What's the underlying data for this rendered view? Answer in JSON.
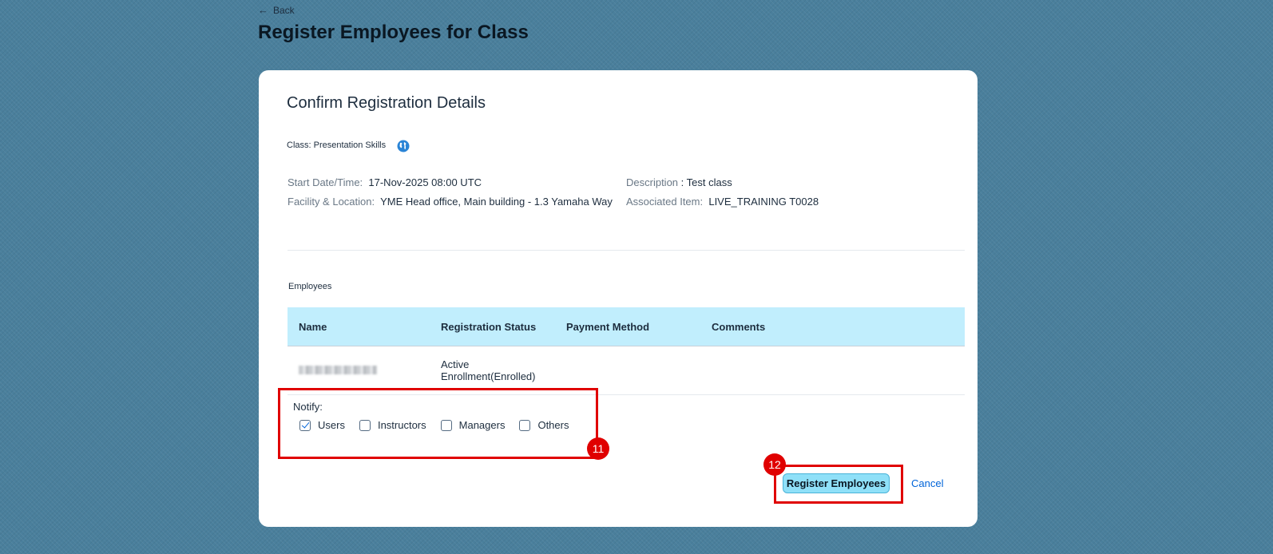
{
  "nav": {
    "back_label": "Back",
    "back_icon": "arrow-left-icon"
  },
  "page": {
    "title": "Register Employees for Class"
  },
  "card": {
    "title": "Confirm Registration Details",
    "class_label": "Class: Presentation Skills",
    "globe_icon": "globe-icon",
    "details": {
      "start_label": "Start Date/Time:",
      "start_value": "17-Nov-2025 08:00 UTC",
      "facility_label": "Facility & Location:",
      "facility_value": "YME Head office, Main building - 1.3 Yamaha Way",
      "description_label": "Description",
      "description_value": ": Test class",
      "associated_label": "Associated Item:",
      "associated_value": "LIVE_TRAINING T0028"
    },
    "employees_label": "Employees",
    "table": {
      "headers": [
        "Name",
        "Registration Status",
        "Payment Method",
        "Comments"
      ],
      "rows": [
        {
          "status": "Active Enrollment(Enrolled)",
          "payment": "",
          "comments": ""
        }
      ]
    },
    "notify": {
      "label": "Notify:",
      "options": [
        {
          "label": "Users",
          "checked": true
        },
        {
          "label": "Instructors",
          "checked": false
        },
        {
          "label": "Managers",
          "checked": false
        },
        {
          "label": "Others",
          "checked": false
        }
      ]
    },
    "annotations": {
      "step_11": "11",
      "step_12": "12",
      "highlight_color": "#e00000"
    },
    "actions": {
      "register_label": "Register Employees",
      "cancel_label": "Cancel"
    }
  },
  "colors": {
    "table_header_bg": "#c1eefd",
    "primary_button_bg": "#8fe0f8",
    "link": "#0064d9",
    "background": "#4a7f9c"
  }
}
